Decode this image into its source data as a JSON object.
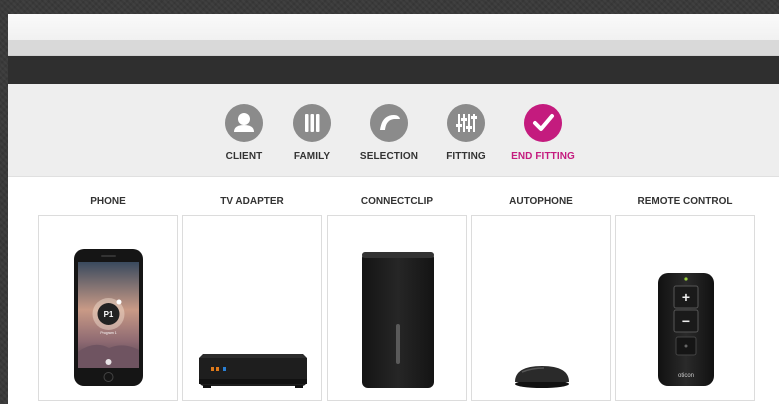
{
  "steps": [
    {
      "label": "CLIENT",
      "icon": "client-icon",
      "active": false
    },
    {
      "label": "FAMILY",
      "icon": "family-icon",
      "active": false
    },
    {
      "label": "SELECTION",
      "icon": "selection-icon",
      "active": false
    },
    {
      "label": "FITTING",
      "icon": "fitting-icon",
      "active": false
    },
    {
      "label": "END FITTING",
      "icon": "checkmark-icon",
      "active": true
    }
  ],
  "devices": [
    {
      "title": "PHONE"
    },
    {
      "title": "TV ADAPTER"
    },
    {
      "title": "CONNECTCLIP"
    },
    {
      "title": "AUTOPHONE"
    },
    {
      "title": "REMOTE CONTROL"
    }
  ],
  "phone_screen": {
    "program_badge": "P1",
    "program_name": "Program 1"
  },
  "remote": {
    "plus": "+",
    "minus": "−",
    "brand": "oticon"
  },
  "colors": {
    "accent": "#c41b7e",
    "step_inactive": "#8b8b8b",
    "device_dark": "#1e1e1e"
  }
}
